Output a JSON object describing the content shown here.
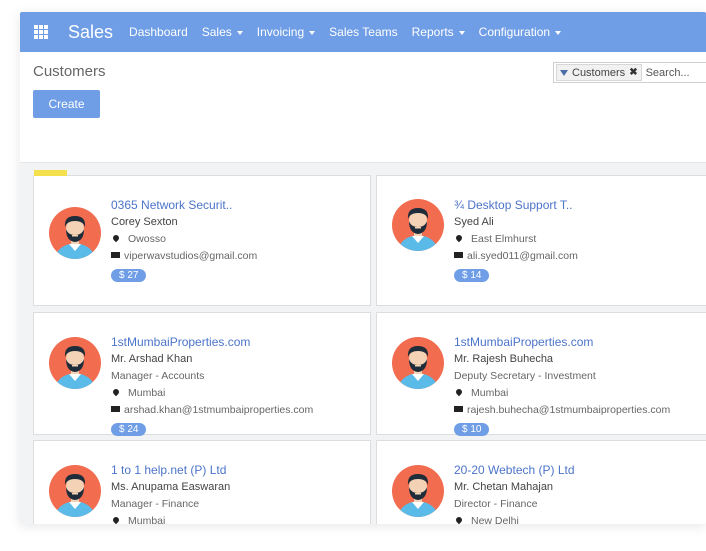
{
  "navbar": {
    "brand": "Sales",
    "menu": [
      {
        "label": "Dashboard",
        "dropdown": false
      },
      {
        "label": "Sales",
        "dropdown": true
      },
      {
        "label": "Invoicing",
        "dropdown": true
      },
      {
        "label": "Sales Teams",
        "dropdown": false
      },
      {
        "label": "Reports",
        "dropdown": true
      },
      {
        "label": "Configuration",
        "dropdown": true
      }
    ]
  },
  "control": {
    "breadcrumb": "Customers",
    "create_label": "Create",
    "search": {
      "facet_label": "Customers",
      "placeholder": "Search..."
    }
  },
  "colors": {
    "navbar": "#6f9ee6",
    "accent_link": "#4c74c9",
    "tag": "#f4e04d",
    "avatar_bg": "#f26c4f"
  },
  "cards": [
    {
      "title": "0365 Network Securit..",
      "name": "Corey Sexton",
      "job": "",
      "city": "Owosso",
      "email": "viperwavstudios@gmail.com",
      "badge": "$ 27",
      "tagged": true
    },
    {
      "title": "¾ Desktop Support T..",
      "name": "Syed Ali",
      "job": "",
      "city": "East Elmhurst",
      "email": "ali.syed011@gmail.com",
      "badge": "$ 14",
      "tagged": false
    },
    {
      "title": "1stMumbaiProperties.com",
      "name": "Mr. Arshad Khan",
      "job": "Manager - Accounts",
      "city": "Mumbai",
      "email": "arshad.khan@1stmumbaiproperties.com",
      "badge": "$ 24",
      "tagged": false
    },
    {
      "title": "1stMumbaiProperties.com",
      "name": "Mr. Rajesh Buhecha",
      "job": "Deputy Secretary - Investment",
      "city": "Mumbai",
      "email": "rajesh.buhecha@1stmumbaiproperties.com",
      "badge": "$ 10",
      "tagged": false
    },
    {
      "title": "1 to 1 help.net (P) Ltd",
      "name": "Ms. Anupama Easwaran",
      "job": "Manager - Finance",
      "city": "Mumbai",
      "email": "",
      "badge": "",
      "tagged": false
    },
    {
      "title": "20-20 Webtech (P) Ltd",
      "name": "Mr. Chetan Mahajan",
      "job": "Director - Finance",
      "city": "New Delhi",
      "email": "",
      "badge": "",
      "tagged": false
    }
  ]
}
